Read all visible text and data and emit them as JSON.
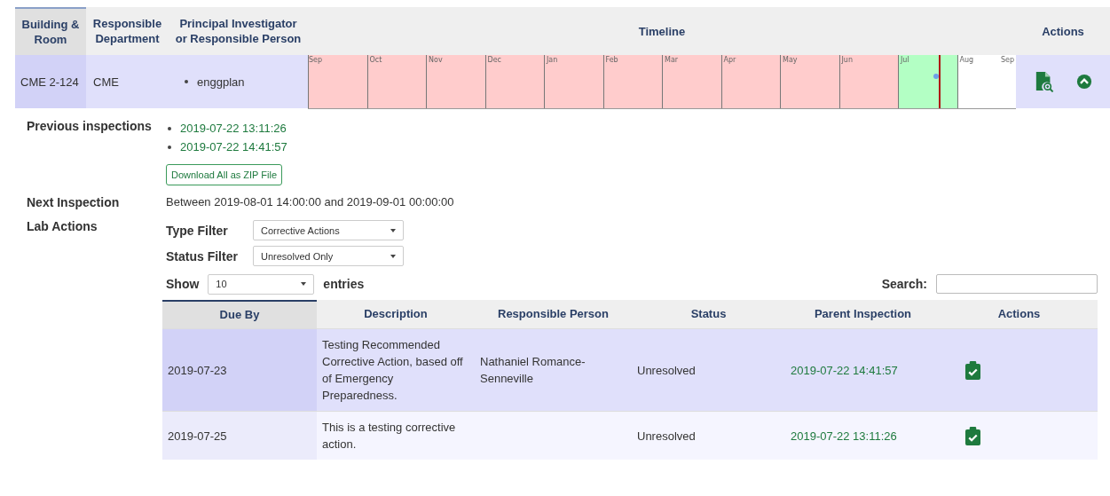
{
  "table": {
    "columns": [
      "Building & Room",
      "Responsible Department",
      "Principal Investigator or Responsible Person",
      "Timeline",
      "Actions"
    ],
    "row": {
      "room": "CME 2-124",
      "department": "CME",
      "people": [
        "enggplan"
      ],
      "timeline": {
        "months": [
          {
            "label": "Sep",
            "color": "#ffcccc"
          },
          {
            "label": "Oct",
            "color": "#ffcccc"
          },
          {
            "label": "Nov",
            "color": "#ffcccc"
          },
          {
            "label": "Dec",
            "color": "#ffcccc"
          },
          {
            "label": "Jan",
            "color": "#ffcccc"
          },
          {
            "label": "Feb",
            "color": "#ffcccc"
          },
          {
            "label": "Mar",
            "color": "#ffcccc"
          },
          {
            "label": "Apr",
            "color": "#ffcccc"
          },
          {
            "label": "May",
            "color": "#ffcccc"
          },
          {
            "label": "Jun",
            "color": "#ffcccc"
          },
          {
            "label": "Jul",
            "color": "#b3ffc4"
          },
          {
            "label": "Aug",
            "color": "#ffffff"
          }
        ],
        "end_label": "Sep"
      },
      "expanded": true
    }
  },
  "details": {
    "previous_label": "Previous inspections",
    "previous": [
      "2019-07-22 13:11:26",
      "2019-07-22 14:41:57"
    ],
    "download_button": "Download All as ZIP File",
    "next_label": "Next Inspection",
    "next_value": "Between 2019-08-01 14:00:00 and 2019-09-01 00:00:00",
    "lab_actions_label": "Lab Actions",
    "filters": [
      {
        "label": "Type Filter",
        "value": "Corrective Actions"
      },
      {
        "label": "Status Filter",
        "value": "Unresolved Only"
      }
    ],
    "show_label": "Show",
    "show_value": "10",
    "entries_label": "entries",
    "search_label": "Search:",
    "actions_table": {
      "columns": [
        "Due By",
        "Description",
        "Responsible Person",
        "Status",
        "Parent Inspection",
        "Actions"
      ],
      "rows": [
        {
          "due": "2019-07-23",
          "description": "Testing Recommended Corrective Action, based off of Emergency Preparedness.",
          "person": "Nathaniel Romance-Senneville",
          "status": "Unresolved",
          "parent": "2019-07-22 14:41:57",
          "selected": true
        },
        {
          "due": "2019-07-25",
          "description": "This is a testing corrective action.",
          "person": "",
          "status": "Unresolved",
          "parent": "2019-07-22 13:11:26",
          "selected": false
        }
      ]
    }
  }
}
